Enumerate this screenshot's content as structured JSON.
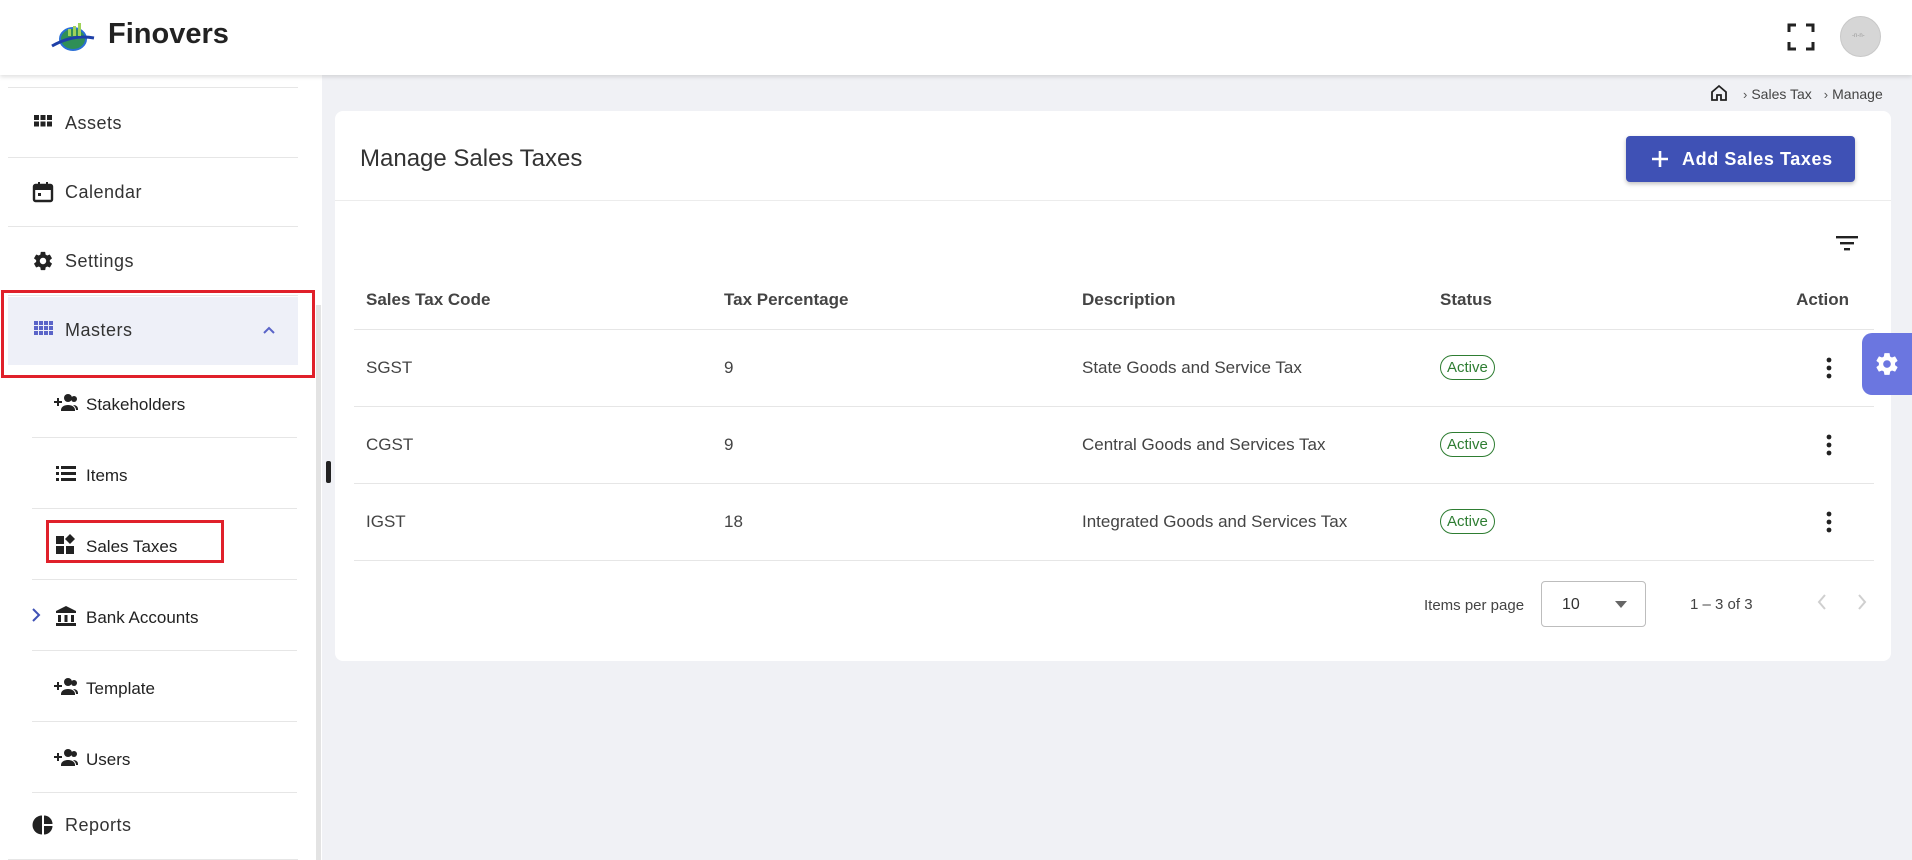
{
  "app": {
    "name": "Finovers"
  },
  "header": {
    "fullscreen_icon": "fullscreen-icon",
    "avatar_text": "-n-n-"
  },
  "sidebar": {
    "menu": [
      {
        "label": "Assets",
        "icon": "grid-icon"
      },
      {
        "label": "Calendar",
        "icon": "calendar-icon"
      },
      {
        "label": "Settings",
        "icon": "gear-icon"
      },
      {
        "label": "Masters",
        "icon": "apps-icon",
        "expanded": true
      },
      {
        "label": "Reports",
        "icon": "pie-chart-icon"
      }
    ],
    "submenu": [
      {
        "label": "Stakeholders",
        "icon": "person-add-icon"
      },
      {
        "label": "Items",
        "icon": "list-icon"
      },
      {
        "label": "Sales Taxes",
        "icon": "dashboard-icon",
        "active": true
      },
      {
        "label": "Bank Accounts",
        "icon": "bank-icon"
      },
      {
        "label": "Template",
        "icon": "person-add-icon"
      },
      {
        "label": "Users",
        "icon": "person-add-icon"
      }
    ]
  },
  "breadcrumb": {
    "items": [
      "Sales Tax",
      "Manage"
    ]
  },
  "page": {
    "title": "Manage Sales Taxes",
    "add_button": "Add Sales Taxes"
  },
  "table": {
    "headers": [
      "Sales Tax Code",
      "Tax Percentage",
      "Description",
      "Status",
      "Action"
    ],
    "rows": [
      {
        "code": "SGST",
        "percentage": "9",
        "description": "State Goods and Service Tax",
        "status": "Active"
      },
      {
        "code": "CGST",
        "percentage": "9",
        "description": "Central Goods and Services Tax",
        "status": "Active"
      },
      {
        "code": "IGST",
        "percentage": "18",
        "description": "Integrated Goods and Services Tax",
        "status": "Active"
      }
    ]
  },
  "pagination": {
    "items_per_page_label": "Items per page",
    "items_per_page": "10",
    "range": "1 – 3 of 3"
  },
  "colors": {
    "primary": "#3f51b5",
    "active": "#2e7d32",
    "highlight": "#e0202a",
    "settings_tab": "#6b76e0"
  }
}
